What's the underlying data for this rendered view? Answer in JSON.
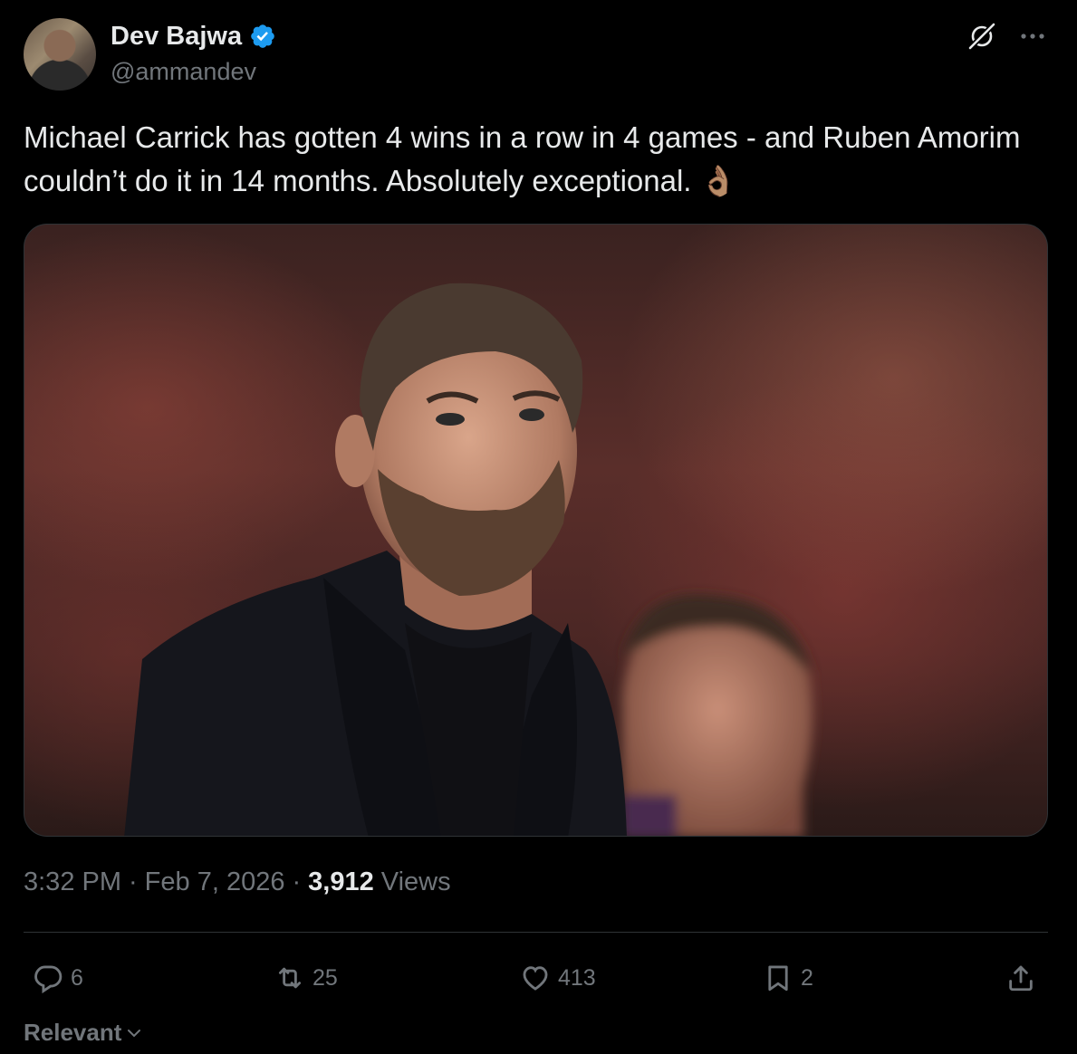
{
  "author": {
    "name": "Dev Bajwa",
    "handle": "@ammandev",
    "verified_color": "#1d9bf0"
  },
  "tweet": {
    "text": "Michael Carrick has gotten 4 wins in a row in 4 games - and Ruben Amorim couldn’t do it in 14 months. Absolutely exceptional. 👌🏽"
  },
  "meta": {
    "time": "3:32 PM",
    "date": "Feb 7, 2026",
    "views_count": "3,912",
    "views_label": "Views"
  },
  "actions": {
    "replies": "6",
    "reposts": "25",
    "likes": "413",
    "bookmarks": "2"
  },
  "sort": {
    "label": "Relevant"
  },
  "icons": [
    "grok-icon",
    "more-icon",
    "verified-badge-icon",
    "reply-icon",
    "repost-icon",
    "like-icon",
    "bookmark-icon",
    "share-icon",
    "chevron-down-icon"
  ],
  "colors": {
    "background": "#000000",
    "text_primary": "#e7e9ea",
    "text_secondary": "#71767b",
    "divider": "#2f3336"
  }
}
